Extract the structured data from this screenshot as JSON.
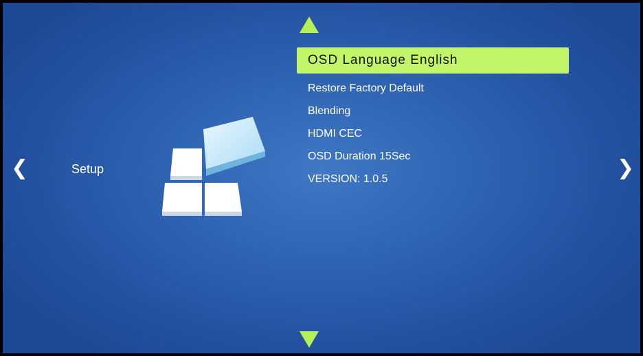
{
  "nav": {
    "up_icon": "triangle-up-icon",
    "down_icon": "triangle-down-icon",
    "left_icon": "chevron-left-icon",
    "right_icon": "chevron-right-icon",
    "left_glyph": "❮",
    "right_glyph": "❯"
  },
  "category": {
    "label": "Setup",
    "icon": "setup-blocks-icon"
  },
  "menu": {
    "items": [
      {
        "label": "OSD Language English",
        "selected": true
      },
      {
        "label": "Restore Factory Default",
        "selected": false
      },
      {
        "label": "Blending",
        "selected": false
      },
      {
        "label": "HDMI CEC",
        "selected": false
      },
      {
        "label": "OSD Duration 15Sec",
        "selected": false
      },
      {
        "label": "VERSION: 1.0.5",
        "selected": false
      }
    ]
  },
  "colors": {
    "background": "#2f64b3",
    "highlight": "#c3f56a",
    "arrow": "#b4f05a",
    "text": "#ffffff"
  }
}
